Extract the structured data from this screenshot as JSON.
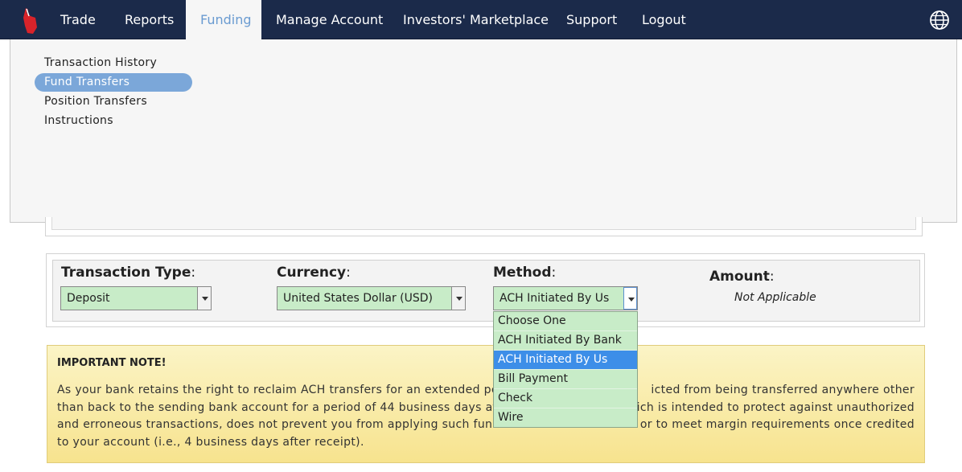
{
  "nav": {
    "items": [
      "Trade",
      "Reports",
      "Funding",
      "Manage Account",
      "Investors' Marketplace",
      "Support",
      "Logout"
    ],
    "active": "Funding"
  },
  "submenu": {
    "items": [
      "Transaction History",
      "Fund Transfers",
      "Position Transfers",
      "Instructions"
    ],
    "selected": "Fund Transfers"
  },
  "form": {
    "transaction_type": {
      "label": "Transaction Type",
      "value": "Deposit"
    },
    "currency": {
      "label": "Currency",
      "value": "United States Dollar (USD)"
    },
    "method": {
      "label": "Method",
      "value": "ACH Initiated By Us"
    },
    "amount": {
      "label": "Amount",
      "value": "Not Applicable"
    },
    "colon": ":"
  },
  "method_options": [
    "Choose One",
    "ACH Initiated By Bank",
    "ACH Initiated By Us",
    "Bill Payment",
    "Check",
    "Wire"
  ],
  "note": {
    "title": "IMPORTANT NOTE!",
    "lines": [
      "As your bank retains the right to reclaim ACH transfers for an extended perio",
      "icted from being transferred anywhere other",
      "than back to the sending bank account for a period of 44 business days after",
      "which is intended to protect against unauthorized",
      "and erroneous transactions, does not prevent you from applying such funds t",
      "s or to meet margin requirements once credited",
      "to your account (i.e., 4 business days after receipt)."
    ]
  },
  "colors": {
    "nav_bg": "#1b2a4a",
    "active_tab_text": "#6a9bd1",
    "selected_submenu": "#7ba7d9",
    "select_bg": "#c8ecc8",
    "option_highlight": "#3d8ee8",
    "note_bg": "#f7e38e"
  }
}
